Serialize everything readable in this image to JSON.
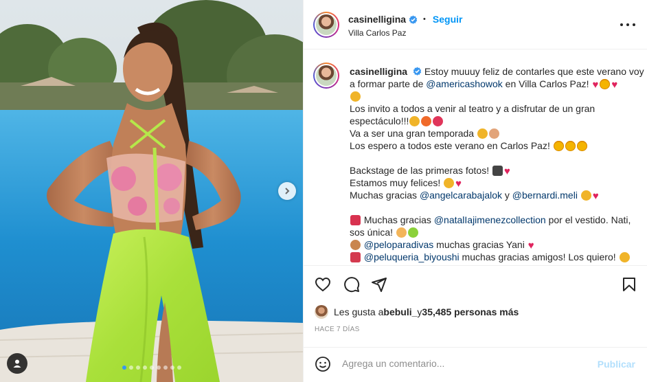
{
  "post": {
    "username": "casinelligina",
    "follow_label": "Seguir",
    "separator": "•",
    "location": "Villa Carlos Paz",
    "carousel": {
      "slide_count": 9,
      "active_index": 0
    },
    "caption": {
      "l1_text": "Estoy muuuy feliz de contarles que este verano voy",
      "l2_a": "a formar parte de ",
      "l2_mention": "@americashowok",
      "l2_b": " en Villa Carlos Paz!",
      "l4": "Los invito a todos a venir al teatro y a disfrutar de un gran",
      "l5": "espectáculo!!!",
      "l6": "Va a ser una gran temporada",
      "l7": "Los espero a todos este verano en Carlos Paz!",
      "l9": "Backstage de las primeras fotos!",
      "l10": "Estamos muy felices!",
      "l11_a": "Muchas gracias ",
      "l11_m1": "@angelcarabajalok",
      "l11_b": " y ",
      "l11_m2": "@bernardi.meli",
      "l13_a": " Muchas gracias ",
      "l13_m": "@natalIajimenezcollection",
      "l13_b": " por el vestido. Nati,",
      "l14": "sos única!",
      "l15_m": "@peloparadivas",
      "l15_b": " muchas gracias Yani",
      "l16_m": "@peluqueria_biyoushi",
      "l16_b": " muchas gracias amigos! Los quiero!"
    },
    "likes": {
      "prefix": "Les gusta a ",
      "user": "bebuli_",
      "middle": " y ",
      "count": "35,485 personas más"
    },
    "timestamp": "HACE 7 DÍAS",
    "comment": {
      "placeholder": "Agrega un comentario...",
      "publish_label": "Publicar"
    }
  },
  "icons": [
    "verified-icon",
    "more-options-icon",
    "heart-icon",
    "comment-icon",
    "share-icon",
    "bookmark-icon",
    "emoji-icon",
    "next-slide-icon",
    "user-tags-icon"
  ],
  "colors": {
    "link": "#0095f6",
    "mention": "#00376b",
    "publish_disabled": "#b2dffc",
    "heart": "#e0245e"
  }
}
